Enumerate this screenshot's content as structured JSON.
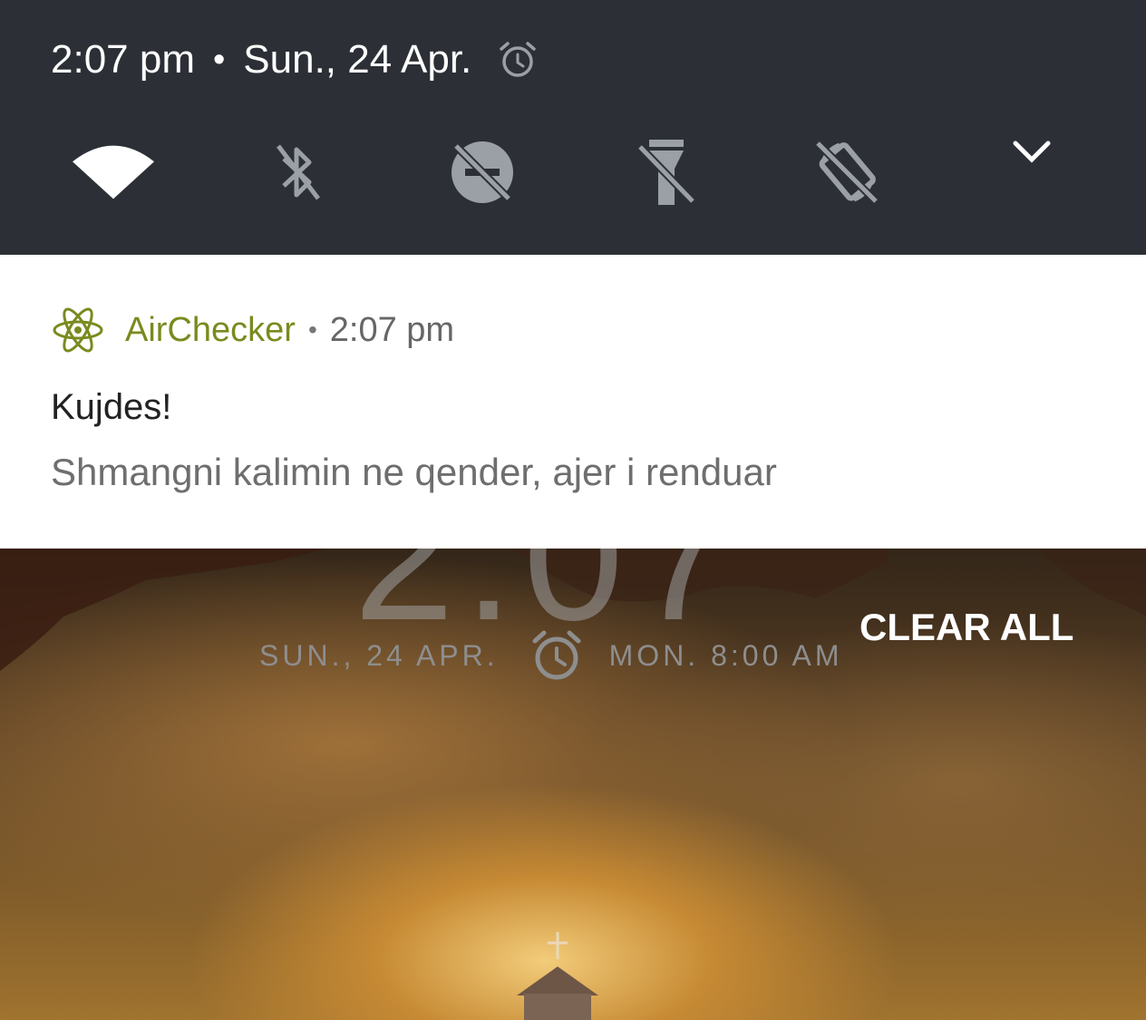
{
  "status_bar": {
    "time": "2:07 pm",
    "separator": "•",
    "date": "Sun., 24 Apr.",
    "alarm_icon": "alarm-clock-icon"
  },
  "quick_settings": {
    "tiles": [
      {
        "name": "wifi",
        "icon": "wifi-icon",
        "state": "on"
      },
      {
        "name": "bluetooth",
        "icon": "bluetooth-off-icon",
        "state": "off"
      },
      {
        "name": "do-not-disturb",
        "icon": "do-not-disturb-off-icon",
        "state": "off"
      },
      {
        "name": "flashlight",
        "icon": "flashlight-off-icon",
        "state": "off"
      },
      {
        "name": "auto-rotate",
        "icon": "rotate-off-icon",
        "state": "off"
      }
    ],
    "expand_icon": "chevron-down-icon"
  },
  "notification": {
    "app_icon": "atom-icon",
    "app_name": "AirChecker",
    "separator": "•",
    "time": "2:07 pm",
    "title": "Kujdes!",
    "text": "Shmangni kalimin ne qender, ajer i renduar"
  },
  "lock_screen": {
    "clock_partial": "2:07",
    "date": "SUN., 24 APR.",
    "next_alarm": "MON. 8:00 AM",
    "clear_all_label": "CLEAR ALL"
  },
  "colors": {
    "shade_bg": "#2c3036",
    "icon_off": "#9aa0a6",
    "app_accent": "#7a8a1e"
  }
}
